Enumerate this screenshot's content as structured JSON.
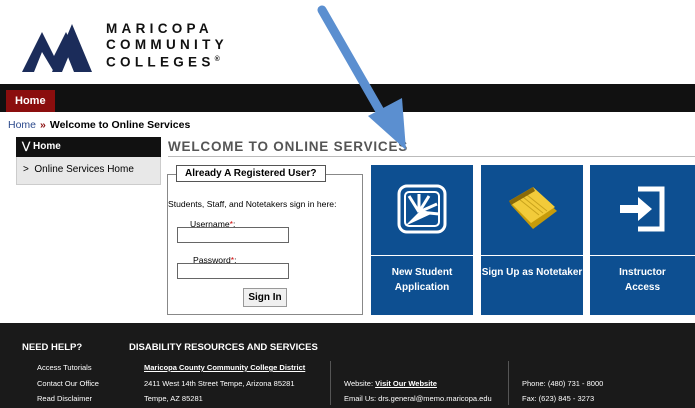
{
  "logo": {
    "lines": [
      "MARICOPA",
      "COMMUNITY",
      "COLLEGES"
    ],
    "registered": "®"
  },
  "nav": {
    "home_tab": "Home"
  },
  "breadcrumb": {
    "home": "Home",
    "separator": "»",
    "current": "Welcome to Online Services"
  },
  "sidebar": {
    "header": "Home",
    "header_icon": "double-chevron-down-icon",
    "items": [
      {
        "label": "Online Services Home",
        "icon": "chevron-right-icon"
      }
    ]
  },
  "main": {
    "title": "WELCOME TO ONLINE SERVICES"
  },
  "login": {
    "legend": "Already A Registered User?",
    "intro": "Students, Staff, and Notetakers sign in here:",
    "username_label": "Username",
    "password_label": "Password",
    "required_mark": "*",
    "label_suffix": ":",
    "signin_label": "Sign In"
  },
  "tiles": [
    {
      "label_line1": "New Student",
      "label_line2": "Application",
      "icon": "sunrise-icon"
    },
    {
      "label_line1": "Sign Up as Notetaker",
      "label_line2": "",
      "icon": "notepad-icon"
    },
    {
      "label_line1": "Instructor",
      "label_line2": "Access",
      "icon": "login-icon"
    }
  ],
  "footer": {
    "help_heading": "NEED HELP?",
    "help_links": [
      "Access Tutorials",
      "Contact Our Office",
      "Read Disclaimer"
    ],
    "drs_heading": "DISABILITY RESOURCES AND SERVICES",
    "district_name": "Maricopa County Community College District",
    "address_line1": "2411 West 14th Street Tempe, Arizona 85281",
    "address_line2": "Tempe, AZ 85281",
    "website_label": "Website: ",
    "website_link": "Visit Our Website",
    "email_line": "Email Us: drs.general@memo.maricopa.edu",
    "phone": "Phone: (480) 731 - 8000",
    "fax": "Fax: (623) 845 - 3273"
  },
  "colors": {
    "brand_navy": "#1b2c5a",
    "nav_red": "#8b0e0e",
    "tile_blue": "#0d4f91",
    "arrow_blue": "#5b8fd0",
    "footer_bg": "#1a1a1a"
  }
}
